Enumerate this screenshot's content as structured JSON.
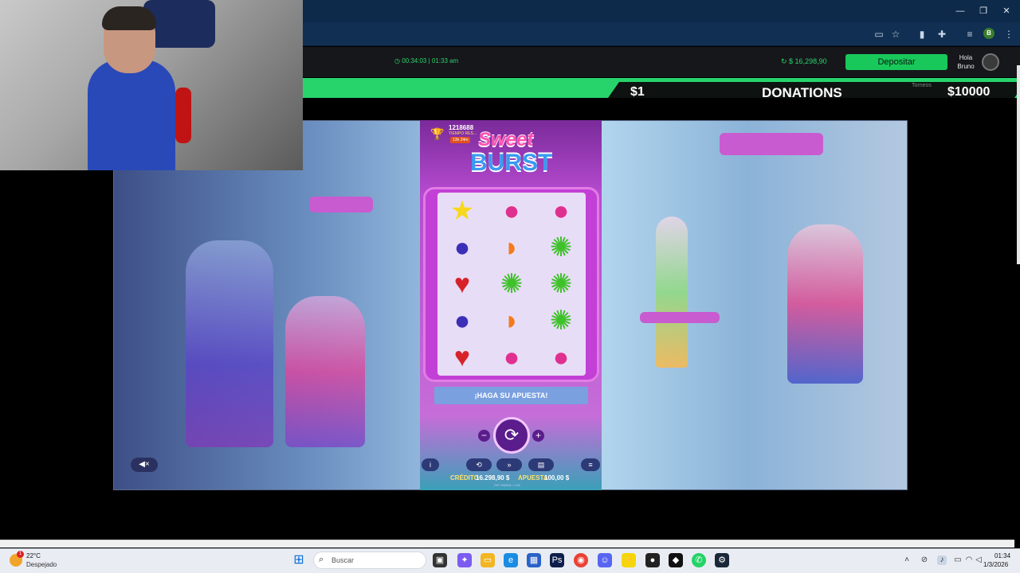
{
  "browser": {
    "window_controls": {
      "minimize": "—",
      "maximize": "❐",
      "close": "✕"
    },
    "profile_initial": "B"
  },
  "casino": {
    "timer": "00:34:03 | 01:33 am",
    "balance": "$ 16,298,90",
    "deposit_label": "Depositar",
    "greeting": "Hola",
    "username": "Bruno"
  },
  "donations": {
    "min": "$1",
    "title": "DONATIONS",
    "max": "$10000",
    "torneos": "Torneos"
  },
  "game": {
    "title_line1": "Sweet",
    "title_line2": "BURST",
    "score": "1218688",
    "score_label": "TIEMPO RES...",
    "score_time": "13h 24m",
    "bet_prompt": "¡HAGA SU APUESTA!",
    "credit_label": "CRÉDITO",
    "credit_value": "16.298,90 $",
    "bet_label": "APUESTA",
    "bet_value": "100,00 $",
    "provider": "FAT PANDA • 1.56",
    "grid": [
      [
        "star",
        "raspberry",
        "raspberry"
      ],
      [
        "plum",
        "orange",
        "kiwi"
      ],
      [
        "strawberry",
        "kiwi",
        "kiwi"
      ],
      [
        "plum",
        "orange",
        "kiwi"
      ],
      [
        "strawberry",
        "raspberry",
        "raspberry"
      ]
    ],
    "symbols": {
      "star": "★",
      "raspberry": "●",
      "plum": "●",
      "orange": "◗",
      "kiwi": "✺",
      "strawberry": "♥"
    },
    "symbol_colors": {
      "star": "#f7d81c",
      "raspberry": "#e0308f",
      "plum": "#3b2fb8",
      "orange": "#f57a1a",
      "kiwi": "#3fc12a",
      "strawberry": "#d8222a"
    }
  },
  "taskbar": {
    "temperature": "22°C",
    "weather": "Despejado",
    "weather_badge": "1",
    "search_placeholder": "Buscar",
    "time": "01:34",
    "date": "1/3/2026"
  }
}
